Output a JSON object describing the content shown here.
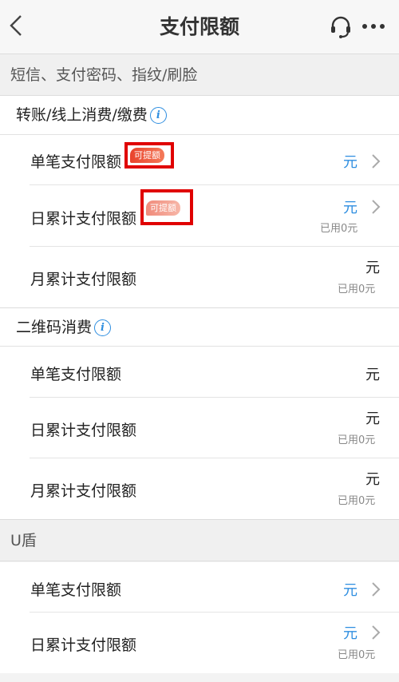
{
  "header": {
    "title": "支付限额",
    "back_icon": "chevron-left-icon",
    "service_icon": "headset-icon",
    "more_icon": "more-dots-icon"
  },
  "section_main": {
    "label": "短信、支付密码、指纹/刷脸"
  },
  "group_transfer": {
    "title": "转账/线上消费/缴费",
    "rows": [
      {
        "label": "单笔支付限额",
        "badge": "可提额",
        "unit": "元",
        "used": ""
      },
      {
        "label": "日累计支付限额",
        "badge": "可提额",
        "unit": "元",
        "used": "已用0元"
      },
      {
        "label": "月累计支付限额",
        "unit": "元",
        "used": "已用0元"
      }
    ]
  },
  "group_qrcode": {
    "title": "二维码消费",
    "rows": [
      {
        "label": "单笔支付限额",
        "unit": "元",
        "used": ""
      },
      {
        "label": "日累计支付限额",
        "unit": "元",
        "used": "已用0元"
      },
      {
        "label": "月累计支付限额",
        "unit": "元",
        "used": "已用0元"
      }
    ]
  },
  "section_ukey": {
    "label": "U盾",
    "rows": [
      {
        "label": "单笔支付限额",
        "unit": "元",
        "used": ""
      },
      {
        "label": "日累计支付限额",
        "unit": "元",
        "used": "已用0元"
      }
    ]
  },
  "colors": {
    "link_blue": "#2e8ee0",
    "badge_red": "#e9432c",
    "highlight_box": "#e00000"
  }
}
